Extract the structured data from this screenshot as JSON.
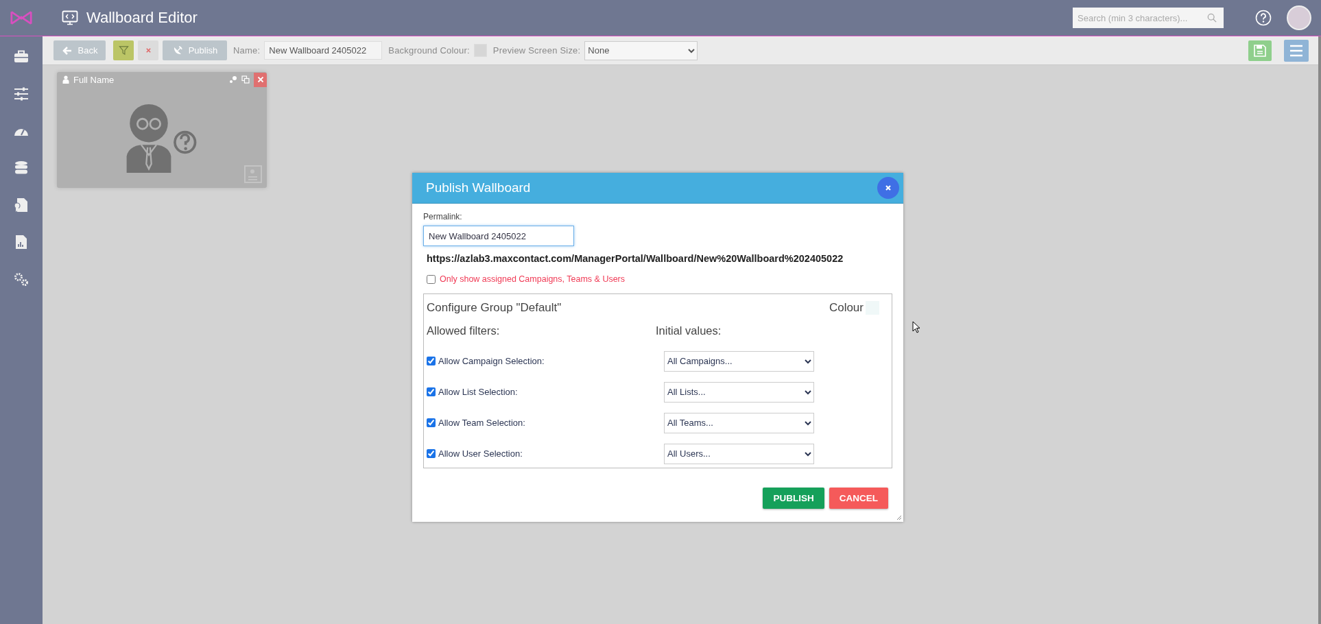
{
  "app": {
    "title": "Wallboard Editor",
    "search": {
      "placeholder": "Search (min 3 characters)..."
    }
  },
  "toolbar": {
    "back": "Back",
    "publish": "Publish",
    "name_label": "Name:",
    "name_value": "New Wallboard 2405022",
    "background_label": "Background Colour:",
    "preview_label": "Preview Screen Size:",
    "preview_value": "None"
  },
  "widget": {
    "title": "Full Name"
  },
  "dialog": {
    "title": "Publish Wallboard",
    "permalink_label": "Permalink:",
    "permalink_value": "New Wallboard 2405022",
    "url": "https://azlab3.maxcontact.com/ManagerPortal/Wallboard/New%20Wallboard%202405022",
    "assigned_only": {
      "label": "Only show assigned Campaigns, Teams & Users",
      "checked": false
    },
    "group_title": "Configure Group \"Default\"",
    "colour_label": "Colour",
    "allowed_heading": "Allowed filters:",
    "initial_heading": "Initial values:",
    "filters": [
      {
        "label": "Allow Campaign Selection:",
        "checked": true,
        "value": "All Campaigns..."
      },
      {
        "label": "Allow List Selection:",
        "checked": true,
        "value": "All Lists..."
      },
      {
        "label": "Allow Team Selection:",
        "checked": true,
        "value": "All Teams..."
      },
      {
        "label": "Allow User Selection:",
        "checked": true,
        "value": "All Users..."
      }
    ],
    "buttons": [
      {
        "label": "PUBLISH",
        "kind": "primary"
      },
      {
        "label": "CANCEL",
        "kind": "danger"
      }
    ]
  }
}
